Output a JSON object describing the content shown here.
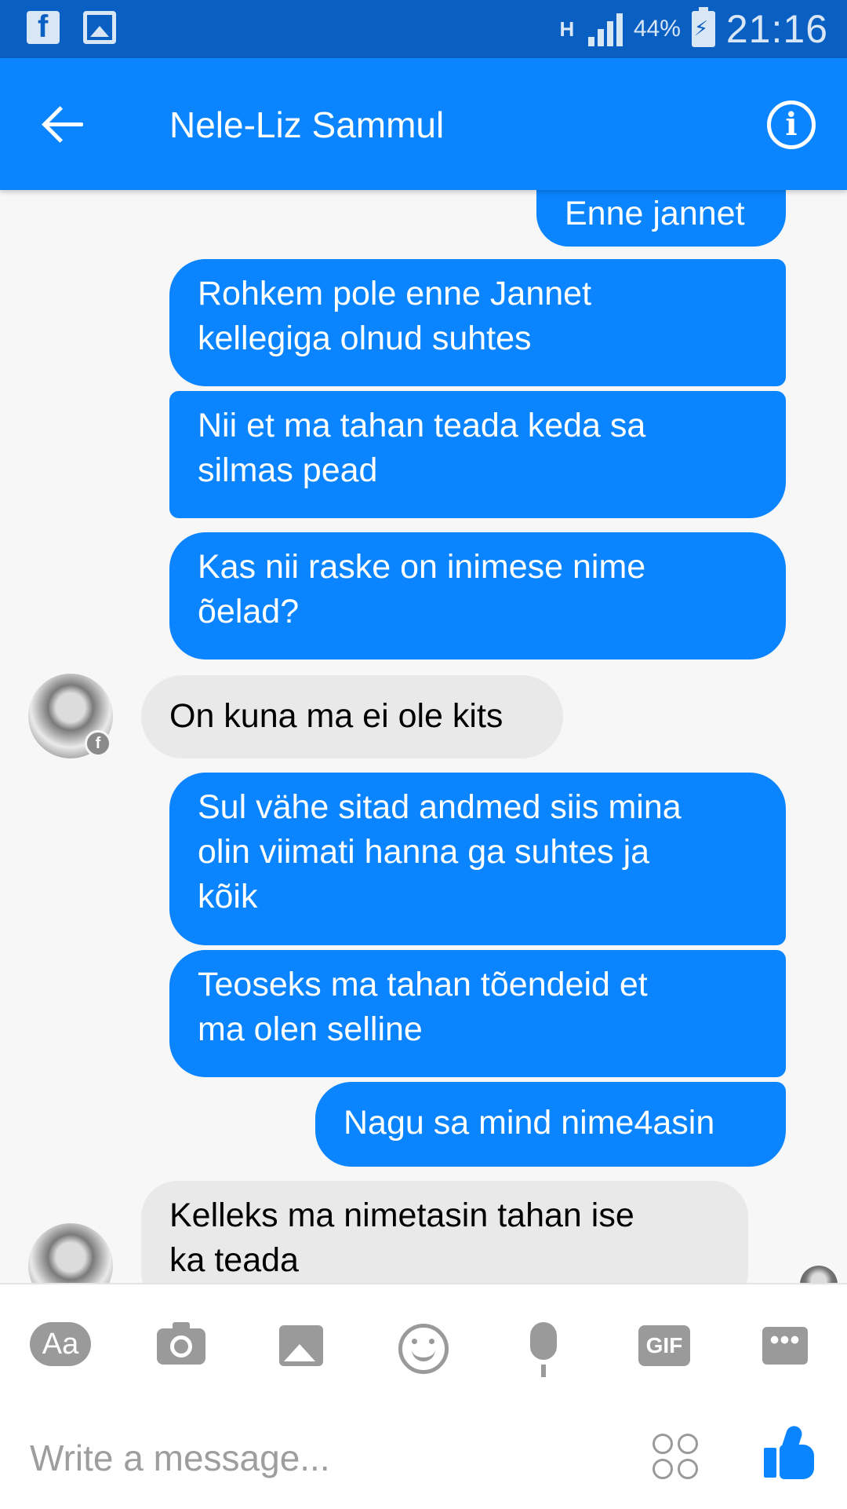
{
  "status_bar": {
    "network_type": "H",
    "battery_percent": "44%",
    "time": "21:16"
  },
  "header": {
    "title": "Nele-Liz Sammul"
  },
  "messages": [
    {
      "direction": "outgoing",
      "text": "Enne jannet"
    },
    {
      "direction": "outgoing",
      "text": "Rohkem pole enne Jannet\nkellegiga olnud suhtes"
    },
    {
      "direction": "outgoing",
      "text": "Nii et ma tahan teada keda sa\nsilmas pead"
    },
    {
      "direction": "outgoing",
      "text": "Kas nii raske on inimese nime\nõelad?"
    },
    {
      "direction": "incoming",
      "text": "On kuna ma ei ole kits"
    },
    {
      "direction": "outgoing",
      "text": "Sul vähe sitad andmed siis mina\nolin viimati hanna ga suhtes ja\nkõik"
    },
    {
      "direction": "outgoing",
      "text": "Teoseks ma tahan tõendeid et\nma olen selline"
    },
    {
      "direction": "outgoing",
      "text": "Nagu sa mind nime4asin"
    },
    {
      "direction": "incoming",
      "text": "Kelleks ma nimetasin tahan ise\nka teada"
    }
  ],
  "composer": {
    "toolbar": {
      "aa_label": "Aa",
      "gif_label": "GIF",
      "more_label": "•••"
    },
    "placeholder": "Write a message..."
  },
  "colors": {
    "accent": "#0a84ff",
    "status_bar": "#0a5fc2",
    "incoming_bubble": "#e9e9e9"
  }
}
